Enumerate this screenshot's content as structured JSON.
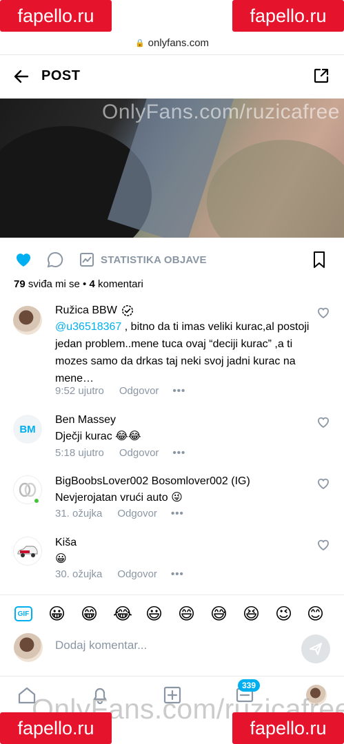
{
  "watermarks": {
    "fapello_label": "fapello.ru",
    "media_watermark": "OnlyFans.com/ruzicafree",
    "bottom_watermark": "OnlyFans.com/ruzicafree"
  },
  "browser": {
    "url": "onlyfans.com"
  },
  "header": {
    "title": "POST"
  },
  "actions": {
    "stats_label": "STATISTIKA OBJAVE"
  },
  "counts": {
    "likes": "79",
    "likes_suffix": " sviđa mi se",
    "separator": " • ",
    "comments": "4",
    "comments_suffix": " komentari"
  },
  "comments": [
    {
      "author": "Ružica BBW",
      "verified": true,
      "mention": "@u36518367",
      "text": " , bitno da ti imas veliki kurac,al postoji jedan problem..mene tuca ovaj “deciji kurac” ,a ti mozes samo da drkas taj neki svoj jadni kurac na mene…",
      "time": "9:52 ujutro",
      "reply_label": "Odgovor"
    },
    {
      "author": "Ben Massey",
      "initials": "BM",
      "text": "Dječji kurac 😂😂",
      "time": "5:18 ujutro",
      "reply_label": "Odgovor"
    },
    {
      "author": "BigBoobsLover002 Bosomlover002 (IG)",
      "text": "Nevjerojatan vrući auto 😜",
      "time": "31. ožujka",
      "reply_label": "Odgovor"
    },
    {
      "author": "Kiša",
      "text": "😀",
      "time": "30. ožujka",
      "reply_label": "Odgovor"
    }
  ],
  "emoji_bar": {
    "gif_label": "GIF",
    "emojis": [
      "😀",
      "😁",
      "😂",
      "😃",
      "😄",
      "😅",
      "😆",
      "😉",
      "😊"
    ]
  },
  "composer": {
    "placeholder": "Dodaj komentar..."
  },
  "tabs": {
    "notifications_badge": "339"
  },
  "colors": {
    "accent": "#00aff0",
    "muted": "#8a96a3",
    "fapello_red": "#e5132c",
    "online": "#44c23a"
  }
}
